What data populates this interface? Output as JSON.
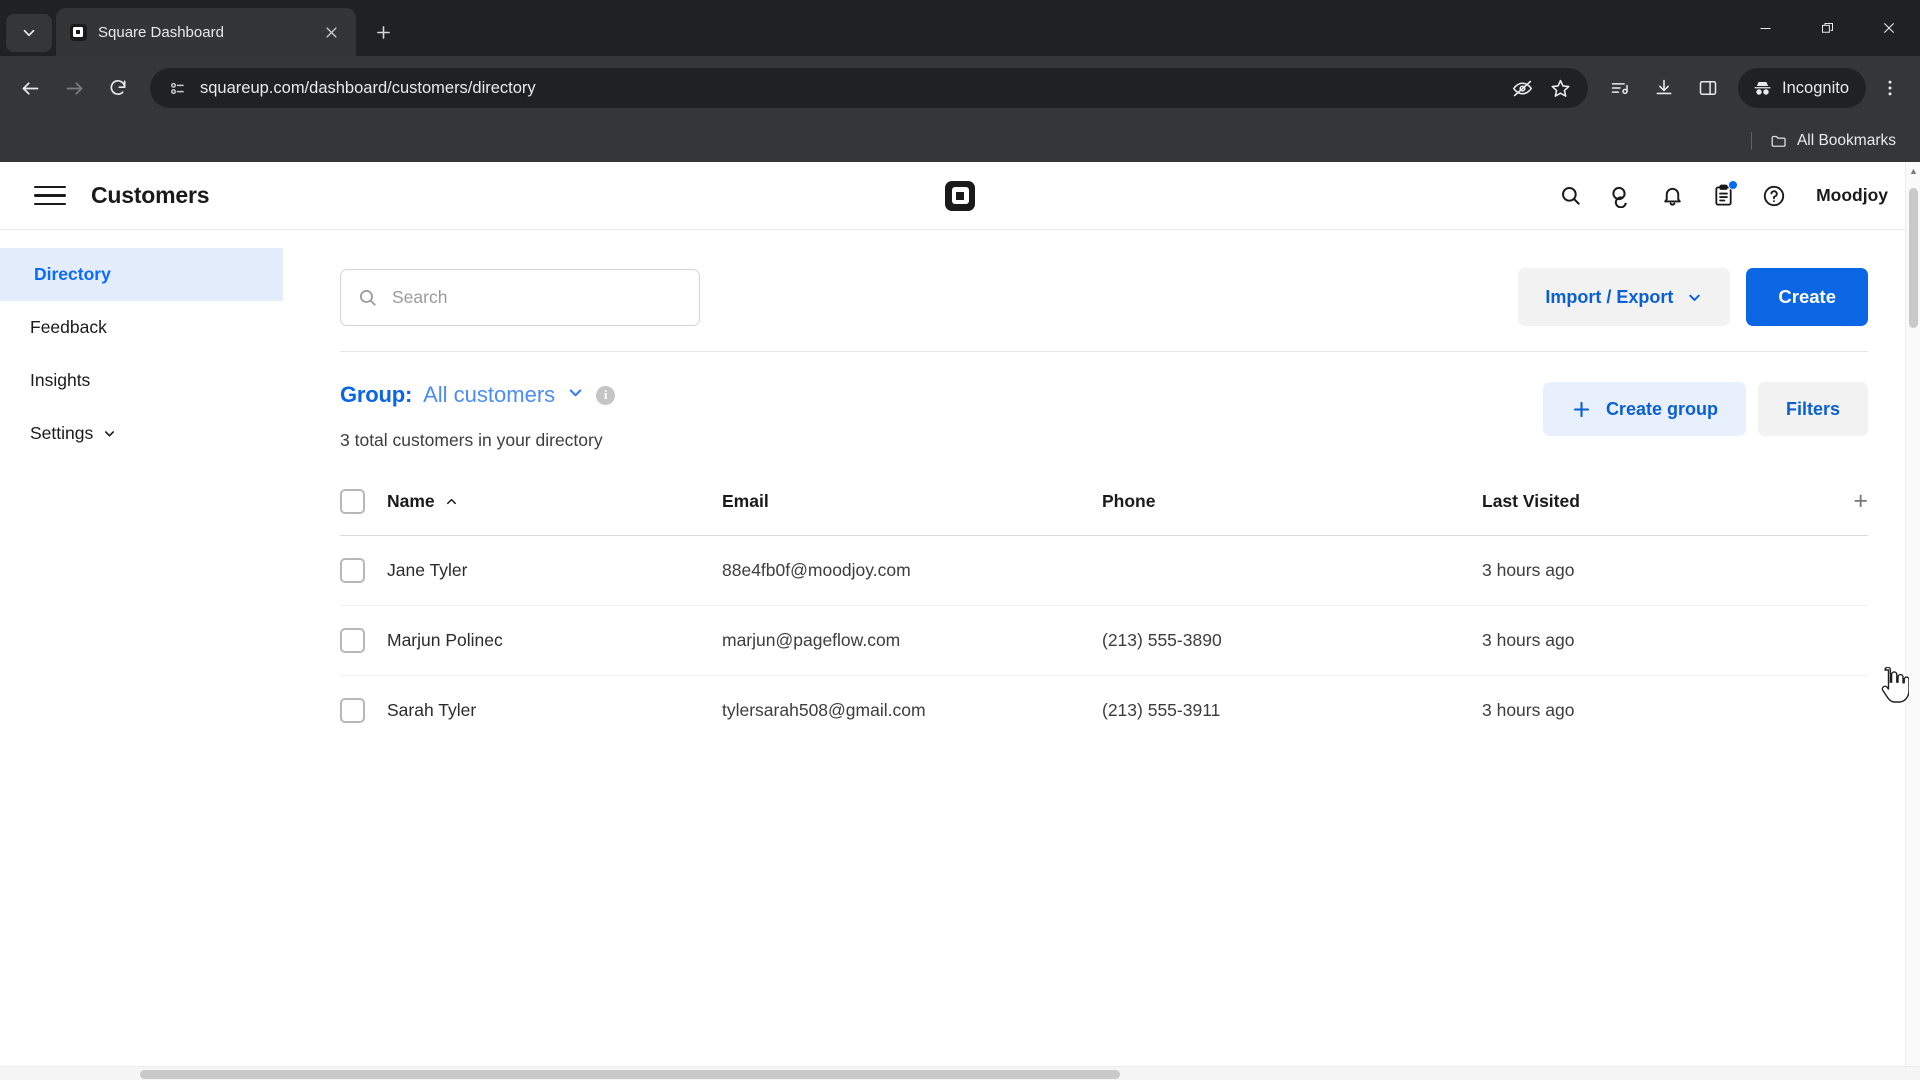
{
  "browser": {
    "tab": {
      "title": "Square Dashboard",
      "favicon": "square-logo-icon"
    },
    "new_tab_label": "+",
    "url": "squareup.com/dashboard/customers/directory",
    "omnibox_icons": [
      "page-info-icon",
      "eye-off-icon",
      "star-icon"
    ],
    "toolbar_icons": [
      "back-arrow-icon",
      "forward-arrow-icon",
      "reload-icon",
      "media-control-icon",
      "download-icon",
      "side-panel-icon"
    ],
    "incognito_label": "Incognito",
    "menu_icon": "kebab-menu-icon",
    "bookmarks": {
      "all_label": "All Bookmarks",
      "folder_icon": "folder-icon"
    },
    "window_controls": [
      "minimize",
      "restore",
      "close"
    ]
  },
  "header": {
    "menu_icon": "hamburger-menu-icon",
    "title": "Customers",
    "logo": "square-logo-icon",
    "icons": [
      "search-icon",
      "messages-icon",
      "bell-icon",
      "clipboard-icon",
      "help-icon"
    ],
    "clipboard_has_badge": true,
    "username": "Moodjoy"
  },
  "sidebar": {
    "items": [
      {
        "label": "Directory",
        "active": true,
        "chevron": false
      },
      {
        "label": "Feedback",
        "active": false,
        "chevron": false
      },
      {
        "label": "Insights",
        "active": false,
        "chevron": false
      },
      {
        "label": "Settings",
        "active": false,
        "chevron": true
      }
    ]
  },
  "toolbar": {
    "search_placeholder": "Search",
    "search_value": "",
    "import_export_label": "Import / Export",
    "create_label": "Create"
  },
  "group": {
    "label": "Group:",
    "value": "All customers",
    "info_icon": "info-icon",
    "subtitle": "3 total customers in your directory",
    "create_group_label": "Create group",
    "create_group_plus": "+",
    "filters_label": "Filters"
  },
  "table": {
    "columns": [
      "Name",
      "Email",
      "Phone",
      "Last Visited"
    ],
    "sort_column": "Name",
    "sort_direction": "asc",
    "add_column_label": "+",
    "rows": [
      {
        "name": "Jane Tyler",
        "email": "88e4fb0f@moodjoy.com",
        "phone": "",
        "last_visited": "3 hours ago"
      },
      {
        "name": "Marjun Polinec",
        "email": "marjun@pageflow.com",
        "phone": "(213) 555-3890",
        "last_visited": "3 hours ago"
      },
      {
        "name": "Sarah Tyler",
        "email": "tylersarah508@gmail.com",
        "phone": "(213) 555-3911",
        "last_visited": "3 hours ago"
      }
    ]
  },
  "colors": {
    "accent_blue": "#0b66e4",
    "link_blue": "#0b5fd4",
    "active_bg": "#e4edfc",
    "badge_blue": "#006aff",
    "chrome_dark": "#35363a"
  }
}
